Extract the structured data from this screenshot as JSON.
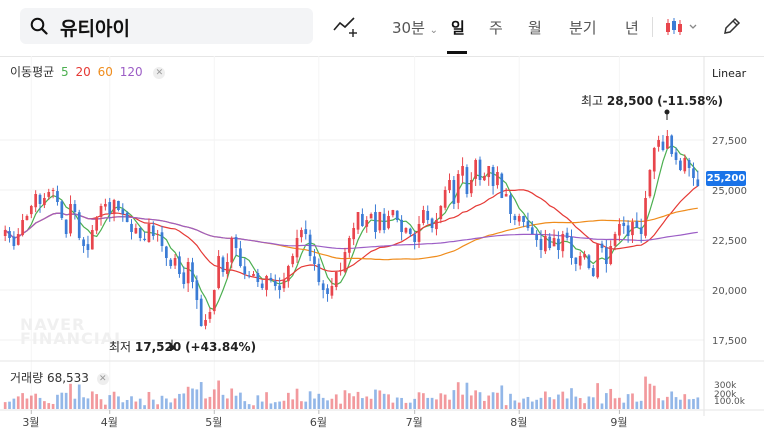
{
  "header": {
    "search_text": "유티아이",
    "period": "30분",
    "tabs": [
      "일",
      "주",
      "월",
      "분기",
      "년"
    ],
    "active_tab": "일",
    "icons": [
      "search-icon",
      "draw-line-icon",
      "candle-chart-icon",
      "pen-icon"
    ]
  },
  "legend": {
    "ma_label": "이동평균",
    "ma": [
      {
        "period": "5",
        "color": "#4caf50"
      },
      {
        "period": "20",
        "color": "#e53935"
      },
      {
        "period": "60",
        "color": "#ef8c1c"
      },
      {
        "period": "120",
        "color": "#9c5ec6"
      }
    ],
    "volume_label": "거래량",
    "volume_value": "68,533"
  },
  "scale_mode": "Linear",
  "annotations": {
    "high_prefix": "최고",
    "high_value": "28,500",
    "high_change": "(-11.58%)",
    "low_prefix": "최저",
    "low_value": "17,520",
    "low_change": "(+43.84%)",
    "current_price": "25,200"
  },
  "watermark": [
    "NAVER",
    "FINANCIAL"
  ],
  "colors": {
    "up": "#e8454c",
    "down": "#3a7bd5",
    "current": "#1a73e8"
  },
  "chart_data": {
    "type": "candlestick",
    "x_ticks": [
      "3월",
      "4월",
      "5월",
      "6월",
      "7월",
      "8월",
      "9월"
    ],
    "y_ticks": [
      "27,500",
      "25,000",
      "22,500",
      "20,000",
      "17,500"
    ],
    "ylim": [
      16500,
      29500
    ],
    "volume_ticks": [
      "300k",
      "200k",
      "100.0k"
    ],
    "close_series": [
      23000,
      22600,
      22200,
      22800,
      23500,
      23700,
      24200,
      24800,
      24300,
      24600,
      24900,
      25000,
      24400,
      23600,
      22800,
      24300,
      23900,
      22600,
      22200,
      22000,
      23000,
      23600,
      24200,
      24300,
      23800,
      24500,
      24000,
      23800,
      23400,
      22900,
      23100,
      22600,
      22500,
      23300,
      22700,
      22800,
      22200,
      21600,
      21200,
      21600,
      20800,
      20300,
      21400,
      20400,
      19500,
      18200,
      18500,
      18900,
      20000,
      21700,
      20900,
      21400,
      22600,
      22100,
      21200,
      20800,
      20700,
      20800,
      20400,
      20100,
      20700,
      20500,
      20200,
      20000,
      20500,
      21200,
      21700,
      22600,
      23000,
      22800,
      21700,
      21300,
      20400,
      20000,
      19800,
      20200,
      20900,
      21000,
      21900,
      22600,
      23100,
      23900,
      23200,
      23500,
      23800,
      22900,
      23900,
      23000,
      23700,
      24000,
      23500,
      22900,
      23100,
      22800,
      22400,
      23300,
      24000,
      23500,
      23100,
      23500,
      24200,
      25000,
      25500,
      24300,
      25800,
      26200,
      24800,
      25500,
      26500,
      25500,
      25700,
      26200,
      25200,
      25900,
      24600,
      24800,
      23800,
      23500,
      23700,
      23400,
      23100,
      22800,
      22500,
      22000,
      22700,
      22100,
      22600,
      22000,
      22800,
      22600,
      21600,
      21300,
      21700,
      21800,
      21100,
      20700,
      22300,
      22100,
      21300,
      22200,
      22800,
      23300,
      23200,
      22700,
      23400,
      23100,
      22800,
      24600,
      26000,
      27100,
      27500,
      27000,
      27700,
      26800,
      26500,
      26000,
      26600,
      26100,
      25600,
      25200
    ]
  }
}
